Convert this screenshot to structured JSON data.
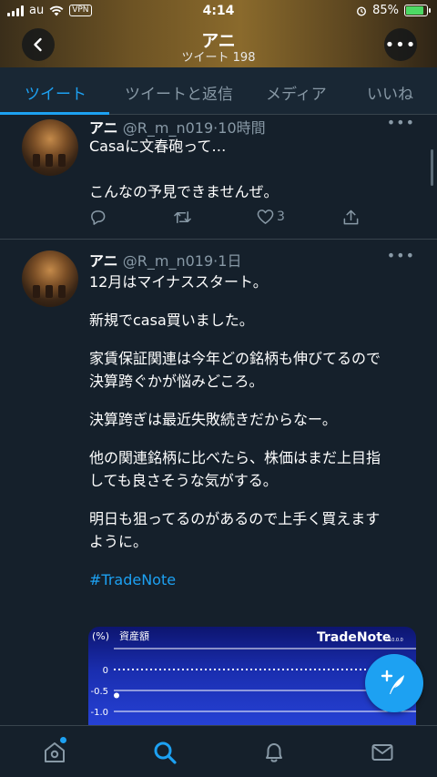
{
  "status_bar": {
    "carrier": "au",
    "vpn": "VPN",
    "time": "4:14",
    "battery": "85%",
    "battery_level": 0.85
  },
  "header": {
    "title": "アニ",
    "subtitle": "ツイート 198"
  },
  "tabs": [
    {
      "label": "ツイート",
      "active": true
    },
    {
      "label": "ツイートと返信",
      "active": false
    },
    {
      "label": "メディア",
      "active": false
    },
    {
      "label": "いいね",
      "active": false
    }
  ],
  "tweets": [
    {
      "name": "アニ",
      "handle": "@R_m_n019",
      "time": "·10時間",
      "lines": [
        "Casaに文春砲って…",
        "",
        "こんなの予見できませんぜ。"
      ],
      "like_count": "3"
    },
    {
      "name": "アニ",
      "handle": "@R_m_n019",
      "time": "·1日",
      "lines": [
        "12月はマイナススタート。",
        "",
        "新規でcasa買いました。",
        "",
        "家賃保証関連は今年どの銘柄も伸びてるので",
        "決算跨ぐかが悩みどころ。",
        "",
        "決算跨ぎは最近失敗続きだからなー。",
        "",
        "他の関連銘柄に比べたら、株価はまだ上目指",
        "しても良さそうな気がする。",
        "",
        "明日も狙ってるのがあるので上手く買えます",
        "ように。",
        ""
      ],
      "hashtag": "#TradeNote"
    }
  ],
  "chart_data": {
    "type": "line",
    "title": "TradeNote",
    "title_suffix": "v10.0.0",
    "ylabel": "(%)",
    "series_label": "資産額",
    "y_ticks": [
      "0",
      "-0.5",
      "-1.0"
    ],
    "series": [
      {
        "values": [
          -0.62
        ]
      }
    ]
  },
  "icons": {
    "back": "chevron-left-icon",
    "more": "more-horizontal-icon",
    "reply": "reply-icon",
    "retweet": "retweet-icon",
    "like": "heart-icon",
    "share": "share-icon",
    "compose": "compose-feather-icon",
    "home": "home-icon",
    "search": "search-icon",
    "notifications": "bell-icon",
    "messages": "mail-icon"
  },
  "colors": {
    "accent": "#1da1f2",
    "background": "#15202b",
    "muted": "#8899a6"
  }
}
